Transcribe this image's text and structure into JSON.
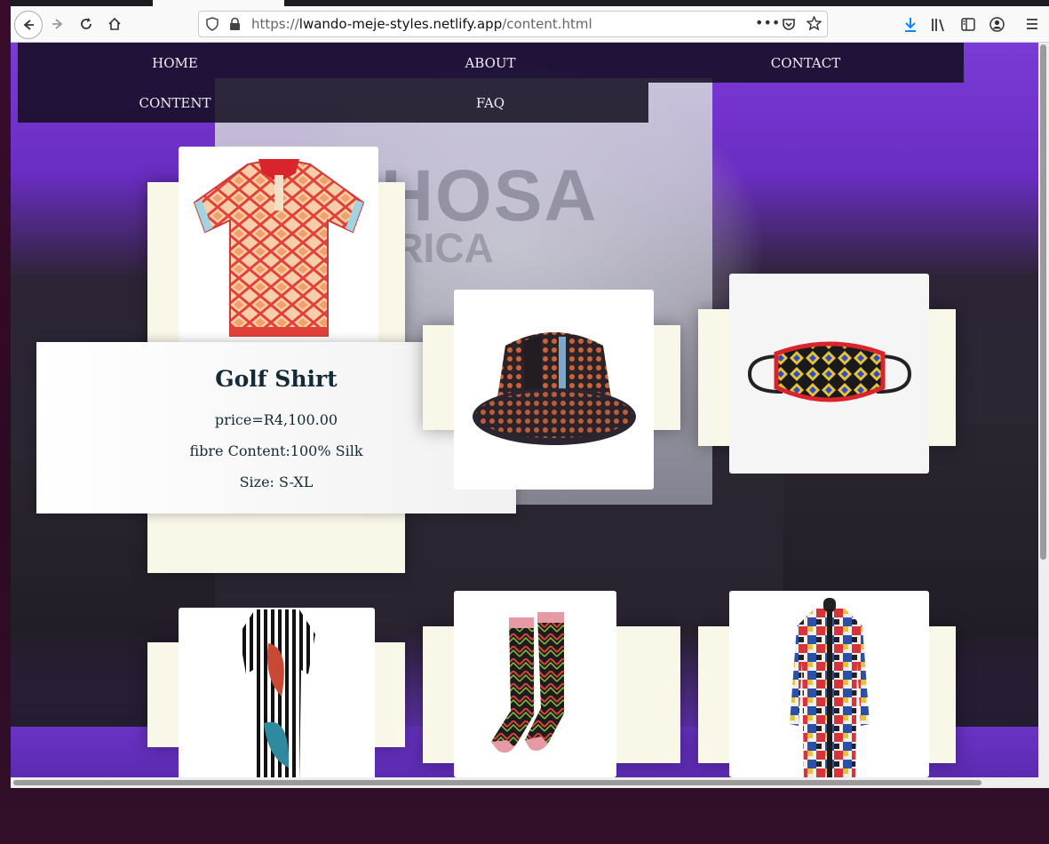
{
  "browser": {
    "url_scheme": "https://",
    "url_host": "lwando-meje-styles.netlify.app",
    "url_path": "/content.html",
    "icons": [
      "back-icon",
      "forward-icon",
      "reload-icon",
      "home-icon",
      "shield-icon",
      "lock-icon",
      "more-icon",
      "pocket-icon",
      "star-icon",
      "download-icon",
      "library-icon",
      "sidebar-icon",
      "account-icon",
      "menu-icon"
    ]
  },
  "background": {
    "banner_line1": "XHOSA",
    "banner_line2": "AFRICA"
  },
  "nav": {
    "home": "HOME",
    "about": "ABOUT",
    "contact": "CONTACT",
    "content": "CONTENT",
    "faq": "FAQ"
  },
  "product": {
    "title": "Golf Shirt",
    "price": "price=R4,100.00",
    "fibre": "fibre Content:100% Silk",
    "size": "Size: S-XL"
  },
  "products": [
    {
      "name": "golf-shirt",
      "icon": "shirt-icon"
    },
    {
      "name": "bucket-hat",
      "icon": "hat-icon"
    },
    {
      "name": "face-mask",
      "icon": "mask-icon"
    },
    {
      "name": "striped-dress",
      "icon": "dress-icon"
    },
    {
      "name": "socks",
      "icon": "socks-icon"
    },
    {
      "name": "long-coat",
      "icon": "coat-icon"
    }
  ]
}
